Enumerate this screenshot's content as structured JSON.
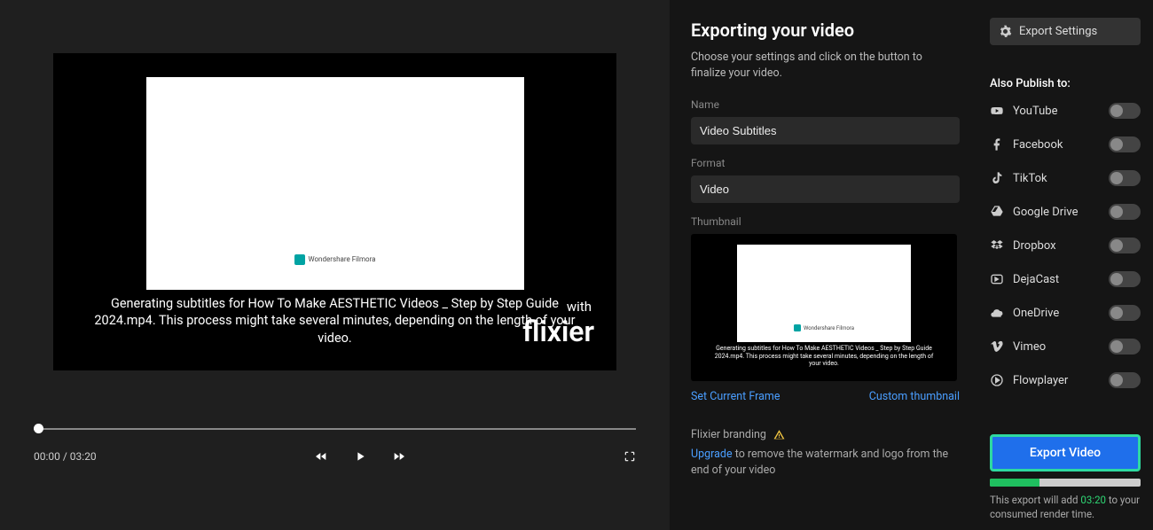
{
  "preview": {
    "filmora_label": "Wondershare Filmora",
    "subtitle_text": "Generating subtitles for How To Make AESTHETIC Videos _ Step by Step Guide 2024.mp4. This process might take several minutes, depending on the length of your video.",
    "brand_with": "with",
    "brand_name": "flixier",
    "time_current": "00:00",
    "time_total": "03:20"
  },
  "settings": {
    "title": "Exporting your video",
    "subtitle": "Choose your settings and click on the button to finalize your video.",
    "name_label": "Name",
    "name_value": "Video Subtitles",
    "format_label": "Format",
    "format_value": "Video",
    "thumbnail_label": "Thumbnail",
    "thumb_sub": "Generating subtitles for How To Make AESTHETIC Videos _ Step by Step Guide 2024.mp4. This process might take several minutes, depending on the length of your video.",
    "set_frame": "Set Current Frame",
    "custom_thumb": "Custom thumbnail",
    "branding_label": "Flixier branding",
    "upgrade_link": "Upgrade",
    "upgrade_rest": " to remove the watermark and logo from the end of your video"
  },
  "side": {
    "export_settings": "Export Settings",
    "publish_label": "Also Publish to:",
    "platforms": [
      "YouTube",
      "Facebook",
      "TikTok",
      "Google Drive",
      "Dropbox",
      "DejaCast",
      "OneDrive",
      "Vimeo",
      "Flowplayer"
    ],
    "export_btn": "Export Video",
    "render_prefix": "This export will add ",
    "render_time": "03:20",
    "render_suffix": " to your consumed render time."
  }
}
